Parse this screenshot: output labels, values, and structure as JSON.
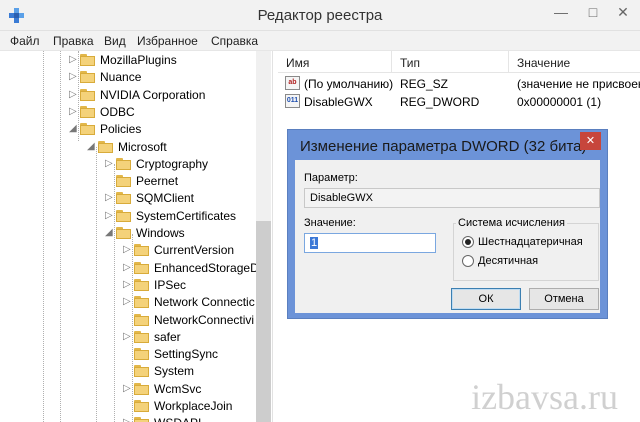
{
  "window": {
    "title": "Редактор реестра"
  },
  "window_buttons": {
    "minimize": "—",
    "maximize": "□",
    "close": "✕"
  },
  "menu": [
    "Файл",
    "Правка",
    "Вид",
    "Избранное",
    "Справка"
  ],
  "tree": {
    "items": [
      {
        "label": "MozillaPlugins",
        "arrow": "▷"
      },
      {
        "label": "Nuance",
        "arrow": "▷"
      },
      {
        "label": "NVIDIA Corporation",
        "arrow": "▷"
      },
      {
        "label": "ODBC",
        "arrow": "▷"
      },
      {
        "label": "Policies",
        "arrow": "◢"
      },
      {
        "label": "Microsoft",
        "arrow": "◢"
      },
      {
        "label": "Cryptography",
        "arrow": "▷"
      },
      {
        "label": "Peernet",
        "arrow": ""
      },
      {
        "label": "SQMClient",
        "arrow": "▷"
      },
      {
        "label": "SystemCertificates",
        "arrow": "▷"
      },
      {
        "label": "Windows",
        "arrow": "◢"
      },
      {
        "label": "CurrentVersion",
        "arrow": "▷"
      },
      {
        "label": "EnhancedStorageD",
        "arrow": "▷"
      },
      {
        "label": "IPSec",
        "arrow": "▷"
      },
      {
        "label": "Network Connectic",
        "arrow": "▷"
      },
      {
        "label": "NetworkConnectivi",
        "arrow": ""
      },
      {
        "label": "safer",
        "arrow": "▷"
      },
      {
        "label": "SettingSync",
        "arrow": ""
      },
      {
        "label": "System",
        "arrow": ""
      },
      {
        "label": "WcmSvc",
        "arrow": "▷"
      },
      {
        "label": "WorkplaceJoin",
        "arrow": ""
      },
      {
        "label": "WSDAPI",
        "arrow": "▷"
      }
    ]
  },
  "listview": {
    "headers": {
      "name": "Имя",
      "type": "Тип",
      "value": "Значение"
    },
    "rows": [
      {
        "icon": "ab",
        "name": "(По умолчанию)",
        "type": "REG_SZ",
        "value": "(значение не присвоен"
      },
      {
        "icon": "011",
        "name": "DisableGWX",
        "type": "REG_DWORD",
        "value": "0x00000001 (1)"
      }
    ]
  },
  "dialog": {
    "title": "Изменение параметра DWORD (32 бита)",
    "close": "✕",
    "param_label": "Параметр:",
    "param_value": "DisableGWX",
    "value_label": "Значение:",
    "value_input": "1",
    "radix_label": "Система исчисления",
    "radix_hex": "Шестнадцатеричная",
    "radix_dec": "Десятичная",
    "radix_selected": "hex",
    "ok": "ОК",
    "cancel": "Отмена"
  },
  "watermark": "izbavsa.ru",
  "colors": {
    "dialog_frame": "#6c93d8",
    "close_button": "#c7463c",
    "folder": "#f4d27a"
  }
}
